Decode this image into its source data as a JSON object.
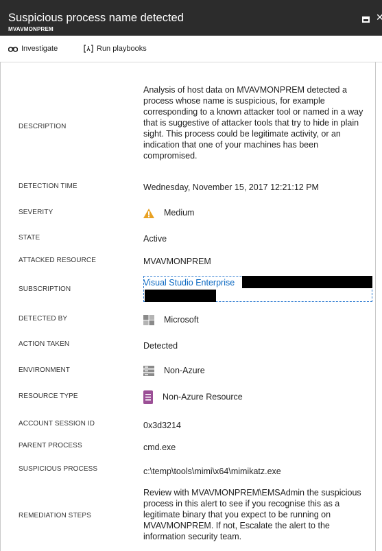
{
  "header": {
    "title": "Suspicious process name detected",
    "subtitle": "MVAVMONPREM"
  },
  "toolbar": {
    "investigate": "Investigate",
    "run_playbooks": "Run playbooks"
  },
  "details": {
    "description": {
      "label": "DESCRIPTION",
      "value": "Analysis of host data on MVAVMONPREM detected a process whose name is suspicious, for example corresponding to a known attacker tool or named in a way that is suggestive of attacker tools that try to hide in plain sight. This process could be legitimate activity, or an indication that one of your machines has been compromised."
    },
    "detection_time": {
      "label": "DETECTION TIME",
      "value": "Wednesday, November 15, 2017 12:21:12 PM"
    },
    "severity": {
      "label": "SEVERITY",
      "value": "Medium",
      "icon": "warning-icon",
      "color": "#e8a123"
    },
    "state": {
      "label": "STATE",
      "value": "Active"
    },
    "attacked_resource": {
      "label": "ATTACKED RESOURCE",
      "value": "MVAVMONPREM"
    },
    "subscription": {
      "label": "SUBSCRIPTION",
      "value": "Visual Studio Enterprise"
    },
    "detected_by": {
      "label": "DETECTED BY",
      "value": "Microsoft",
      "icon": "microsoft-logo-icon"
    },
    "action_taken": {
      "label": "ACTION TAKEN",
      "value": "Detected"
    },
    "environment": {
      "label": "ENVIRONMENT",
      "value": "Non-Azure",
      "icon": "server-icon"
    },
    "resource_type": {
      "label": "RESOURCE TYPE",
      "value": "Non-Azure Resource",
      "icon": "resource-icon",
      "color": "#9b4f96"
    },
    "account_session_id": {
      "label": "ACCOUNT SESSION ID",
      "value": "0x3d3214"
    },
    "parent_process": {
      "label": "PARENT PROCESS",
      "value": "cmd.exe"
    },
    "suspicious_process": {
      "label": "SUSPICIOUS PROCESS",
      "value": "c:\\temp\\tools\\mimi\\x64\\mimikatz.exe"
    },
    "remediation_steps": {
      "label": "REMEDIATION STEPS",
      "value": "Review with MVAVMONPREM\\EMSAdmin the suspicious process in this alert to see if you recognise this as a legitimate binary that you expect to be running on MVAVMONPREM. If not, Escalate the alert to the information security team."
    }
  }
}
